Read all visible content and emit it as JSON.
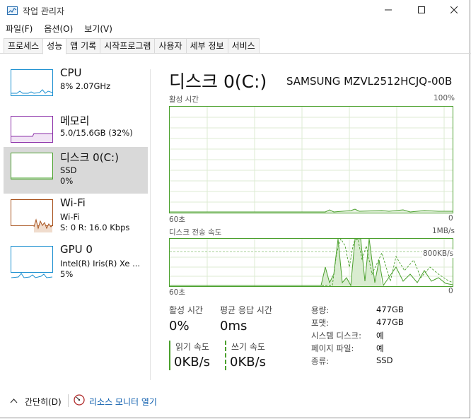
{
  "window": {
    "title": "작업 관리자",
    "minimize_icon": "minimize-icon",
    "maximize_icon": "maximize-icon",
    "close_icon": "close-icon"
  },
  "menu": [
    "파일(F)",
    "옵션(O)",
    "보기(V)"
  ],
  "tabs": [
    {
      "label": "프로세스",
      "active": false
    },
    {
      "label": "성능",
      "active": true
    },
    {
      "label": "앱 기록",
      "active": false
    },
    {
      "label": "시작프로그램",
      "active": false
    },
    {
      "label": "사용자",
      "active": false
    },
    {
      "label": "세부 정보",
      "active": false
    },
    {
      "label": "서비스",
      "active": false
    }
  ],
  "sidebar": {
    "items": [
      {
        "title": "CPU",
        "line1": "8% 2.07GHz",
        "line2": "",
        "line3": "",
        "color": "#1a8fd0"
      },
      {
        "title": "메모리",
        "line1": "5.0/15.6GB (32%)",
        "line2": "",
        "line3": "",
        "color": "#8b2fa8"
      },
      {
        "title": "디스크 0(C:)",
        "line1": "SSD",
        "line2": "0%",
        "line3": "",
        "color": "#4aa02c",
        "selected": true
      },
      {
        "title": "Wi-Fi",
        "line1": "Wi-Fi",
        "line2": "S: 0  R: 16.0 Kbps",
        "line3": "",
        "color": "#a7501a"
      },
      {
        "title": "GPU 0",
        "line1": "Intel(R) Iris(R) Xe ...",
        "line2": "5%",
        "line3": "",
        "color": "#1a8fd0"
      }
    ]
  },
  "main": {
    "title": "디스크 0(C:)",
    "model": "SAMSUNG MZVL2512HCJQ-00B",
    "active_time_label": "활성 시간",
    "active_time_max": "100%",
    "graph1_left": "60초",
    "graph1_right": "0",
    "transfer_label": "디스크 전송 속도",
    "transfer_max": "1MB/s",
    "transfer_mid": "800KB/s",
    "graph2_left": "60초",
    "graph2_right": "0",
    "stats": {
      "active_label": "활성 시간",
      "active_value": "0%",
      "response_label": "평균 응답 시간",
      "response_value": "0ms",
      "read_label": "읽기 속도",
      "read_value": "0KB/s",
      "write_label": "쓰기 속도",
      "write_value": "0KB/s"
    },
    "properties": [
      {
        "label": "용량:",
        "value": "477GB"
      },
      {
        "label": "포맷:",
        "value": "477GB"
      },
      {
        "label": "시스템 디스크:",
        "value": "예"
      },
      {
        "label": "페이지 파일:",
        "value": "예"
      },
      {
        "label": "종류:",
        "value": "SSD"
      }
    ]
  },
  "footer": {
    "brief": "간단히(D)",
    "resmon": "리소스 모니터 열기"
  },
  "colors": {
    "disk_green": "#4aa02c",
    "selected_bg": "#d9d9d9",
    "link_blue": "#0b5cad"
  }
}
